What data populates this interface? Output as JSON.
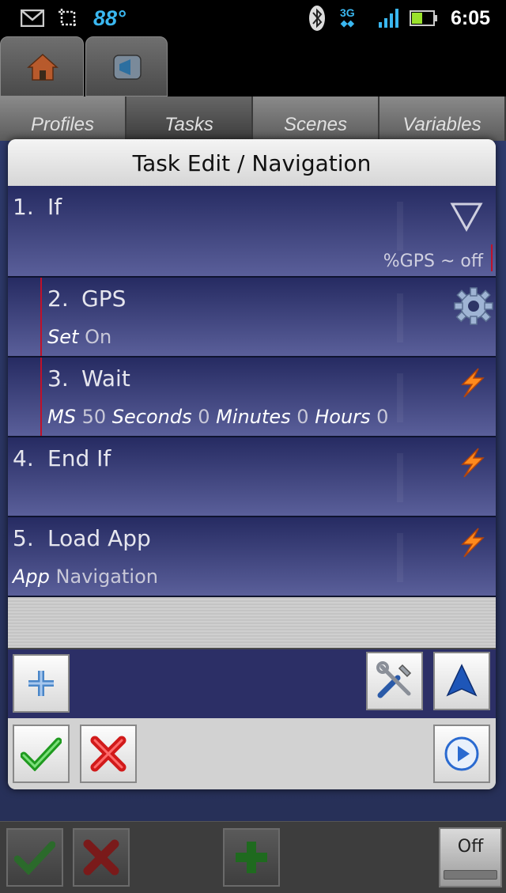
{
  "status_bar": {
    "temperature": "88°",
    "network": "3G",
    "time": "6:05"
  },
  "main_tabs": [
    "Profiles",
    "Tasks",
    "Scenes",
    "Variables"
  ],
  "dialog": {
    "title": "Task Edit / Navigation",
    "actions": [
      {
        "num": "1.",
        "name": "If",
        "condition": "%GPS ~ off",
        "icon": "triangle-down-icon"
      },
      {
        "num": "2.",
        "name": "GPS",
        "arg_label": "Set",
        "arg_value": "On",
        "icon": "gear-icon"
      },
      {
        "num": "3.",
        "name": "Wait",
        "args": [
          {
            "label": "MS",
            "value": "50"
          },
          {
            "label": "Seconds",
            "value": "0"
          },
          {
            "label": "Minutes",
            "value": "0"
          },
          {
            "label": "Hours",
            "value": "0"
          }
        ],
        "icon": "lightning-icon"
      },
      {
        "num": "4.",
        "name": "End If",
        "icon": "lightning-icon"
      },
      {
        "num": "5.",
        "name": "Load App",
        "arg_label": "App",
        "arg_value": "Navigation",
        "icon": "lightning-icon"
      }
    ]
  },
  "bottom_bar": {
    "toggle_label": "Off"
  },
  "colors": {
    "action_bg_top": "#262b62",
    "action_bg_bottom": "#5a5f9a",
    "indent_marker": "#c0112a",
    "accent_blue": "#3ab7f0"
  }
}
